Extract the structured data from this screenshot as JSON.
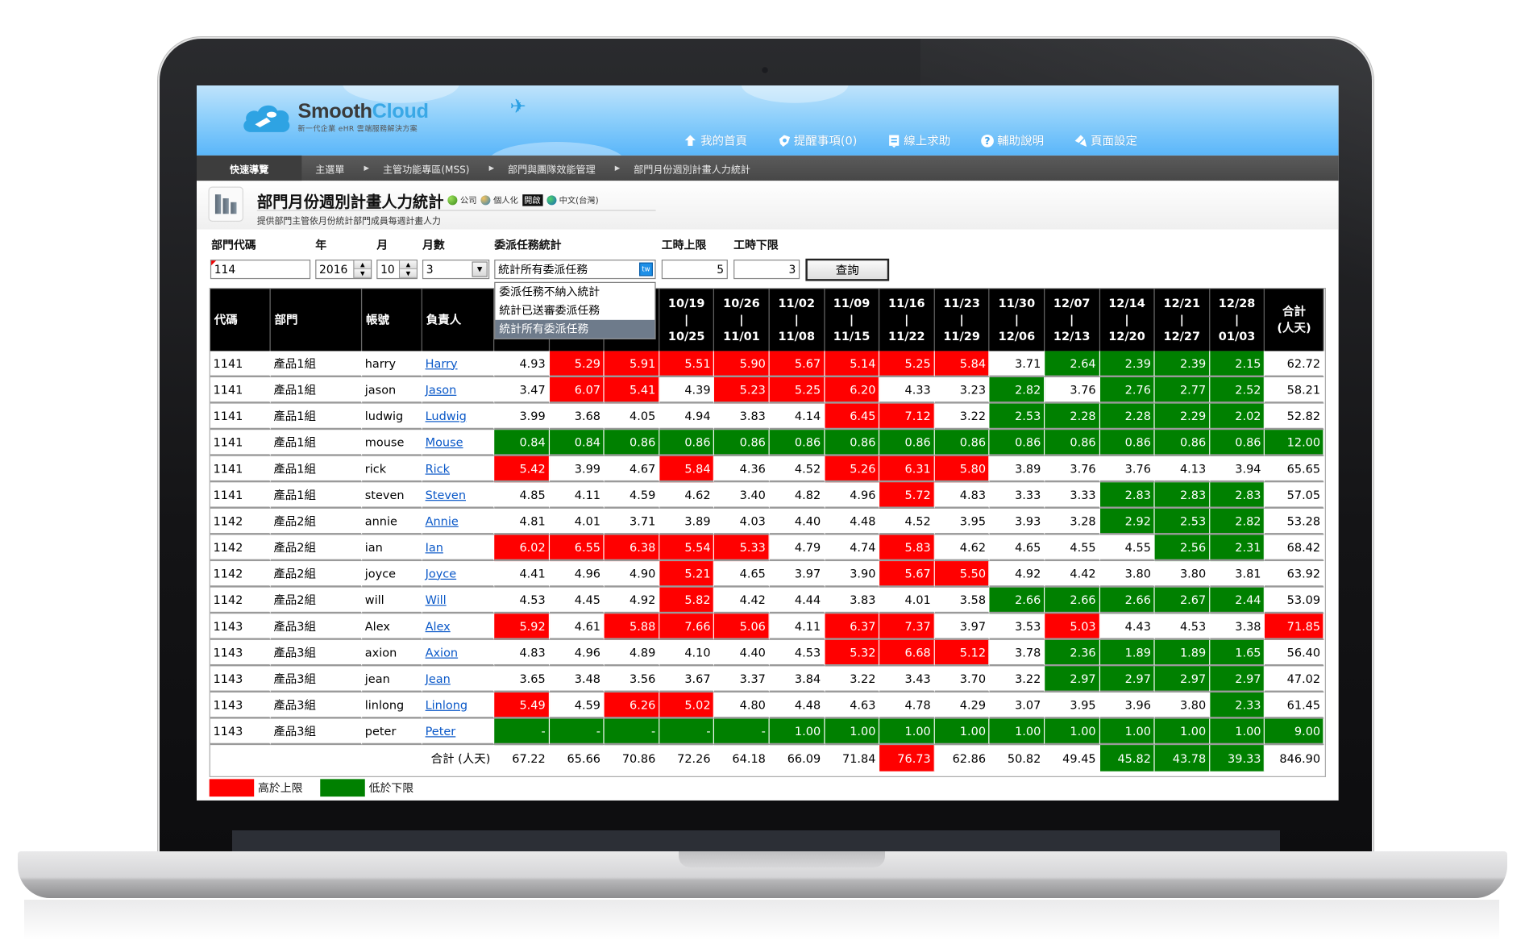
{
  "app": {
    "logo_name_a": "Smooth",
    "logo_name_b": "Cloud",
    "logo_tagline": "新一代企業 eHR 雲端服務解決方案"
  },
  "top_nav": [
    {
      "label": "我的首頁",
      "icon": "home-icon"
    },
    {
      "label": "提醒事項(0)",
      "icon": "reminder-icon"
    },
    {
      "label": "線上求助",
      "icon": "help-desk-icon"
    },
    {
      "label": "輔助說明",
      "icon": "question-icon"
    },
    {
      "label": "頁面設定",
      "icon": "page-settings-icon"
    }
  ],
  "breadcrumb": {
    "quick_nav": "快速導覽",
    "items": [
      "主選單",
      "主管功能專區(MSS)",
      "部門與團隊效能管理",
      "部門月份週別計畫人力統計"
    ]
  },
  "page": {
    "title": "部門月份週別計畫人力統計",
    "subtitle": "提供部門主管依月份統計部門成員每週計畫人力",
    "badges": {
      "company": "公司",
      "personalize": "個人化",
      "open": "開啟",
      "language": "中文(台灣)"
    }
  },
  "form": {
    "labels": {
      "dept_code": "部門代碼",
      "year": "年",
      "month": "月",
      "months": "月數",
      "delegation": "委派任務統計",
      "upper": "工時上限",
      "lower": "工時下限"
    },
    "values": {
      "dept_code": "114",
      "year": "2016",
      "month": "10",
      "months": "3",
      "delegation": "統計所有委派任務",
      "upper": "5",
      "lower": "3"
    },
    "tw_label": "tw",
    "query_label": "查詢",
    "delegation_options": [
      "委派任務不納入統計",
      "統計已送審委派任務",
      "統計所有委派任務"
    ],
    "delegation_selected_index": 2
  },
  "table": {
    "headers": {
      "code": "代碼",
      "dept": "部門",
      "account": "帳號",
      "owner": "負責人",
      "total_line1": "合計",
      "total_line2": "(人天)"
    },
    "weeks": [
      {
        "from": "",
        "to": ""
      },
      {
        "from": "",
        "to": ""
      },
      {
        "from": "",
        "to": ""
      },
      {
        "from": "10/19",
        "to": "10/25"
      },
      {
        "from": "10/26",
        "to": "11/01"
      },
      {
        "from": "11/02",
        "to": "11/08"
      },
      {
        "from": "11/09",
        "to": "11/15"
      },
      {
        "from": "11/16",
        "to": "11/22"
      },
      {
        "from": "11/23",
        "to": "11/29"
      },
      {
        "from": "11/30",
        "to": "12/06"
      },
      {
        "from": "12/07",
        "to": "12/13"
      },
      {
        "from": "12/14",
        "to": "12/20"
      },
      {
        "from": "12/21",
        "to": "12/27"
      },
      {
        "from": "12/28",
        "to": "01/03"
      }
    ],
    "rows": [
      {
        "code": "1141",
        "dept": "產品1組",
        "account": "harry",
        "owner": "Harry",
        "values": [
          "4.93",
          "5.29",
          "5.91",
          "5.51",
          "5.90",
          "5.67",
          "5.14",
          "5.25",
          "5.84",
          "3.71",
          "2.64",
          "2.39",
          "2.39",
          "2.15"
        ],
        "total": "62.72"
      },
      {
        "code": "1141",
        "dept": "產品1組",
        "account": "jason",
        "owner": "Jason",
        "values": [
          "3.47",
          "6.07",
          "5.41",
          "4.39",
          "5.23",
          "5.25",
          "6.20",
          "4.33",
          "3.23",
          "2.82",
          "3.76",
          "2.76",
          "2.77",
          "2.52"
        ],
        "total": "58.21"
      },
      {
        "code": "1141",
        "dept": "產品1組",
        "account": "ludwig",
        "owner": "Ludwig",
        "values": [
          "3.99",
          "3.68",
          "4.05",
          "4.94",
          "3.83",
          "4.14",
          "6.45",
          "7.12",
          "3.22",
          "2.53",
          "2.28",
          "2.28",
          "2.29",
          "2.02"
        ],
        "total": "52.82"
      },
      {
        "code": "1141",
        "dept": "產品1組",
        "account": "mouse",
        "owner": "Mouse",
        "values": [
          "0.84",
          "0.84",
          "0.86",
          "0.86",
          "0.86",
          "0.86",
          "0.86",
          "0.86",
          "0.86",
          "0.86",
          "0.86",
          "0.86",
          "0.86",
          "0.86"
        ],
        "total": "12.00"
      },
      {
        "code": "1141",
        "dept": "產品1組",
        "account": "rick",
        "owner": "Rick",
        "values": [
          "5.42",
          "3.99",
          "4.67",
          "5.84",
          "4.36",
          "4.52",
          "5.26",
          "6.31",
          "5.80",
          "3.89",
          "3.76",
          "3.76",
          "4.13",
          "3.94"
        ],
        "total": "65.65"
      },
      {
        "code": "1141",
        "dept": "產品1組",
        "account": "steven",
        "owner": "Steven",
        "values": [
          "4.85",
          "4.11",
          "4.59",
          "4.62",
          "3.40",
          "4.82",
          "4.96",
          "5.72",
          "4.83",
          "3.33",
          "3.33",
          "2.83",
          "2.83",
          "2.83"
        ],
        "total": "57.05"
      },
      {
        "code": "1142",
        "dept": "產品2組",
        "account": "annie",
        "owner": "Annie",
        "values": [
          "4.81",
          "4.01",
          "3.71",
          "3.89",
          "4.03",
          "4.40",
          "4.48",
          "4.52",
          "3.95",
          "3.93",
          "3.28",
          "2.92",
          "2.53",
          "2.82"
        ],
        "total": "53.28"
      },
      {
        "code": "1142",
        "dept": "產品2組",
        "account": "ian",
        "owner": "Ian",
        "values": [
          "6.02",
          "6.55",
          "6.38",
          "5.54",
          "5.33",
          "4.79",
          "4.74",
          "5.83",
          "4.62",
          "4.65",
          "4.55",
          "4.55",
          "2.56",
          "2.31"
        ],
        "total": "68.42"
      },
      {
        "code": "1142",
        "dept": "產品2組",
        "account": "joyce",
        "owner": "Joyce",
        "values": [
          "4.41",
          "4.96",
          "4.90",
          "5.21",
          "4.65",
          "3.97",
          "3.90",
          "5.67",
          "5.50",
          "4.92",
          "4.42",
          "3.80",
          "3.80",
          "3.81"
        ],
        "total": "63.92"
      },
      {
        "code": "1142",
        "dept": "產品2組",
        "account": "will",
        "owner": "Will",
        "values": [
          "4.53",
          "4.45",
          "4.92",
          "5.82",
          "4.42",
          "4.44",
          "3.83",
          "4.01",
          "3.58",
          "2.66",
          "2.66",
          "2.66",
          "2.67",
          "2.44"
        ],
        "total": "53.09"
      },
      {
        "code": "1143",
        "dept": "產品3組",
        "account": "Alex",
        "owner": "Alex",
        "values": [
          "5.92",
          "4.61",
          "5.88",
          "7.66",
          "5.06",
          "4.11",
          "6.37",
          "7.37",
          "3.97",
          "3.53",
          "5.03",
          "4.43",
          "4.53",
          "3.38"
        ],
        "total": "71.85"
      },
      {
        "code": "1143",
        "dept": "產品3組",
        "account": "axion",
        "owner": "Axion",
        "values": [
          "4.83",
          "4.96",
          "4.89",
          "4.10",
          "4.40",
          "4.53",
          "5.32",
          "6.68",
          "5.12",
          "3.78",
          "2.36",
          "1.89",
          "1.89",
          "1.65"
        ],
        "total": "56.40"
      },
      {
        "code": "1143",
        "dept": "產品3組",
        "account": "jean",
        "owner": "Jean",
        "values": [
          "3.65",
          "3.48",
          "3.56",
          "3.67",
          "3.37",
          "3.84",
          "3.22",
          "3.43",
          "3.70",
          "3.22",
          "2.97",
          "2.97",
          "2.97",
          "2.97"
        ],
        "total": "47.02"
      },
      {
        "code": "1143",
        "dept": "產品3組",
        "account": "linlong",
        "owner": "Linlong",
        "values": [
          "5.49",
          "4.59",
          "6.26",
          "5.02",
          "4.80",
          "4.48",
          "4.63",
          "4.78",
          "4.29",
          "3.07",
          "3.95",
          "3.96",
          "3.80",
          "2.33"
        ],
        "total": "61.45"
      },
      {
        "code": "1143",
        "dept": "產品3組",
        "account": "peter",
        "owner": "Peter",
        "values": [
          "-",
          "-",
          "-",
          "-",
          "-",
          "1.00",
          "1.00",
          "1.00",
          "1.00",
          "1.00",
          "1.00",
          "1.00",
          "1.00",
          "1.00"
        ],
        "total": "9.00",
        "all_low": true
      }
    ],
    "totals": {
      "label": "合計 (人天)",
      "values": [
        "67.22",
        "65.66",
        "70.86",
        "72.26",
        "64.18",
        "66.09",
        "71.84",
        "76.73",
        "62.86",
        "50.82",
        "49.45",
        "45.82",
        "43.78",
        "39.33"
      ],
      "total": "846.90"
    },
    "week_total_thresholds": {
      "upper_total": 75,
      "lower_total": 45
    },
    "grand_total_thresholds": {
      "upper_total": 70,
      "lower_total": 42
    }
  },
  "legend": [
    {
      "label": "高於上限",
      "color": "#ff0000"
    },
    {
      "label": "低於下限",
      "color": "#008000"
    }
  ],
  "colors": {
    "high": "#ff0000",
    "low": "#008000",
    "header_bg": "#000000",
    "link": "#0a58c8",
    "selected_option": "#6e7b8b"
  }
}
